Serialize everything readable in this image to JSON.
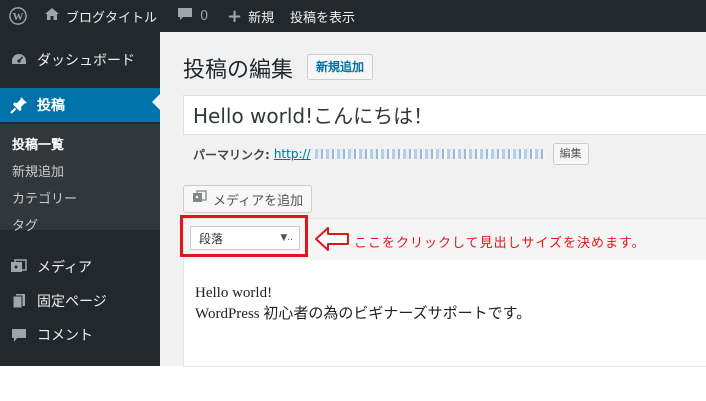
{
  "admin_bar": {
    "logo_icon": "wordpress-logo-icon",
    "site_icon": "home-icon",
    "site_name": "ブログタイトル",
    "comments_icon": "speech-bubble-icon",
    "comments_count": "0",
    "new_icon": "plus-icon",
    "new_label": "新規",
    "view_post_label": "投稿を表示"
  },
  "sidebar": {
    "items": [
      {
        "icon": "dashboard-gauge-icon",
        "label": "ダッシュボード"
      },
      {
        "icon": "pin-icon",
        "label": "投稿"
      },
      {
        "icon": "media-icon",
        "label": "メディア"
      },
      {
        "icon": "page-icon",
        "label": "固定ページ"
      },
      {
        "icon": "comment-icon",
        "label": "コメント"
      }
    ],
    "submenu": [
      "投稿一覧",
      "新規追加",
      "カテゴリー",
      "タグ"
    ]
  },
  "main": {
    "page_title": "投稿の編集",
    "add_new_label": "新規追加",
    "post_title": "Hello world!こんにちは！",
    "permalink_label": "パーマリンク:",
    "permalink_url": "http://",
    "edit_slug_label": "編集",
    "add_media_label": "メディアを追加",
    "format_select_value": "段落",
    "annotation": "ここをクリックして見出しサイズを決めます。",
    "content_lines": [
      "Hello world!",
      "WordPress 初心者の為のビギナーズサポートです。"
    ]
  },
  "colors": {
    "admin_dark": "#23282d",
    "accent_blue": "#0073aa",
    "annotation_red": "#e0161b"
  }
}
